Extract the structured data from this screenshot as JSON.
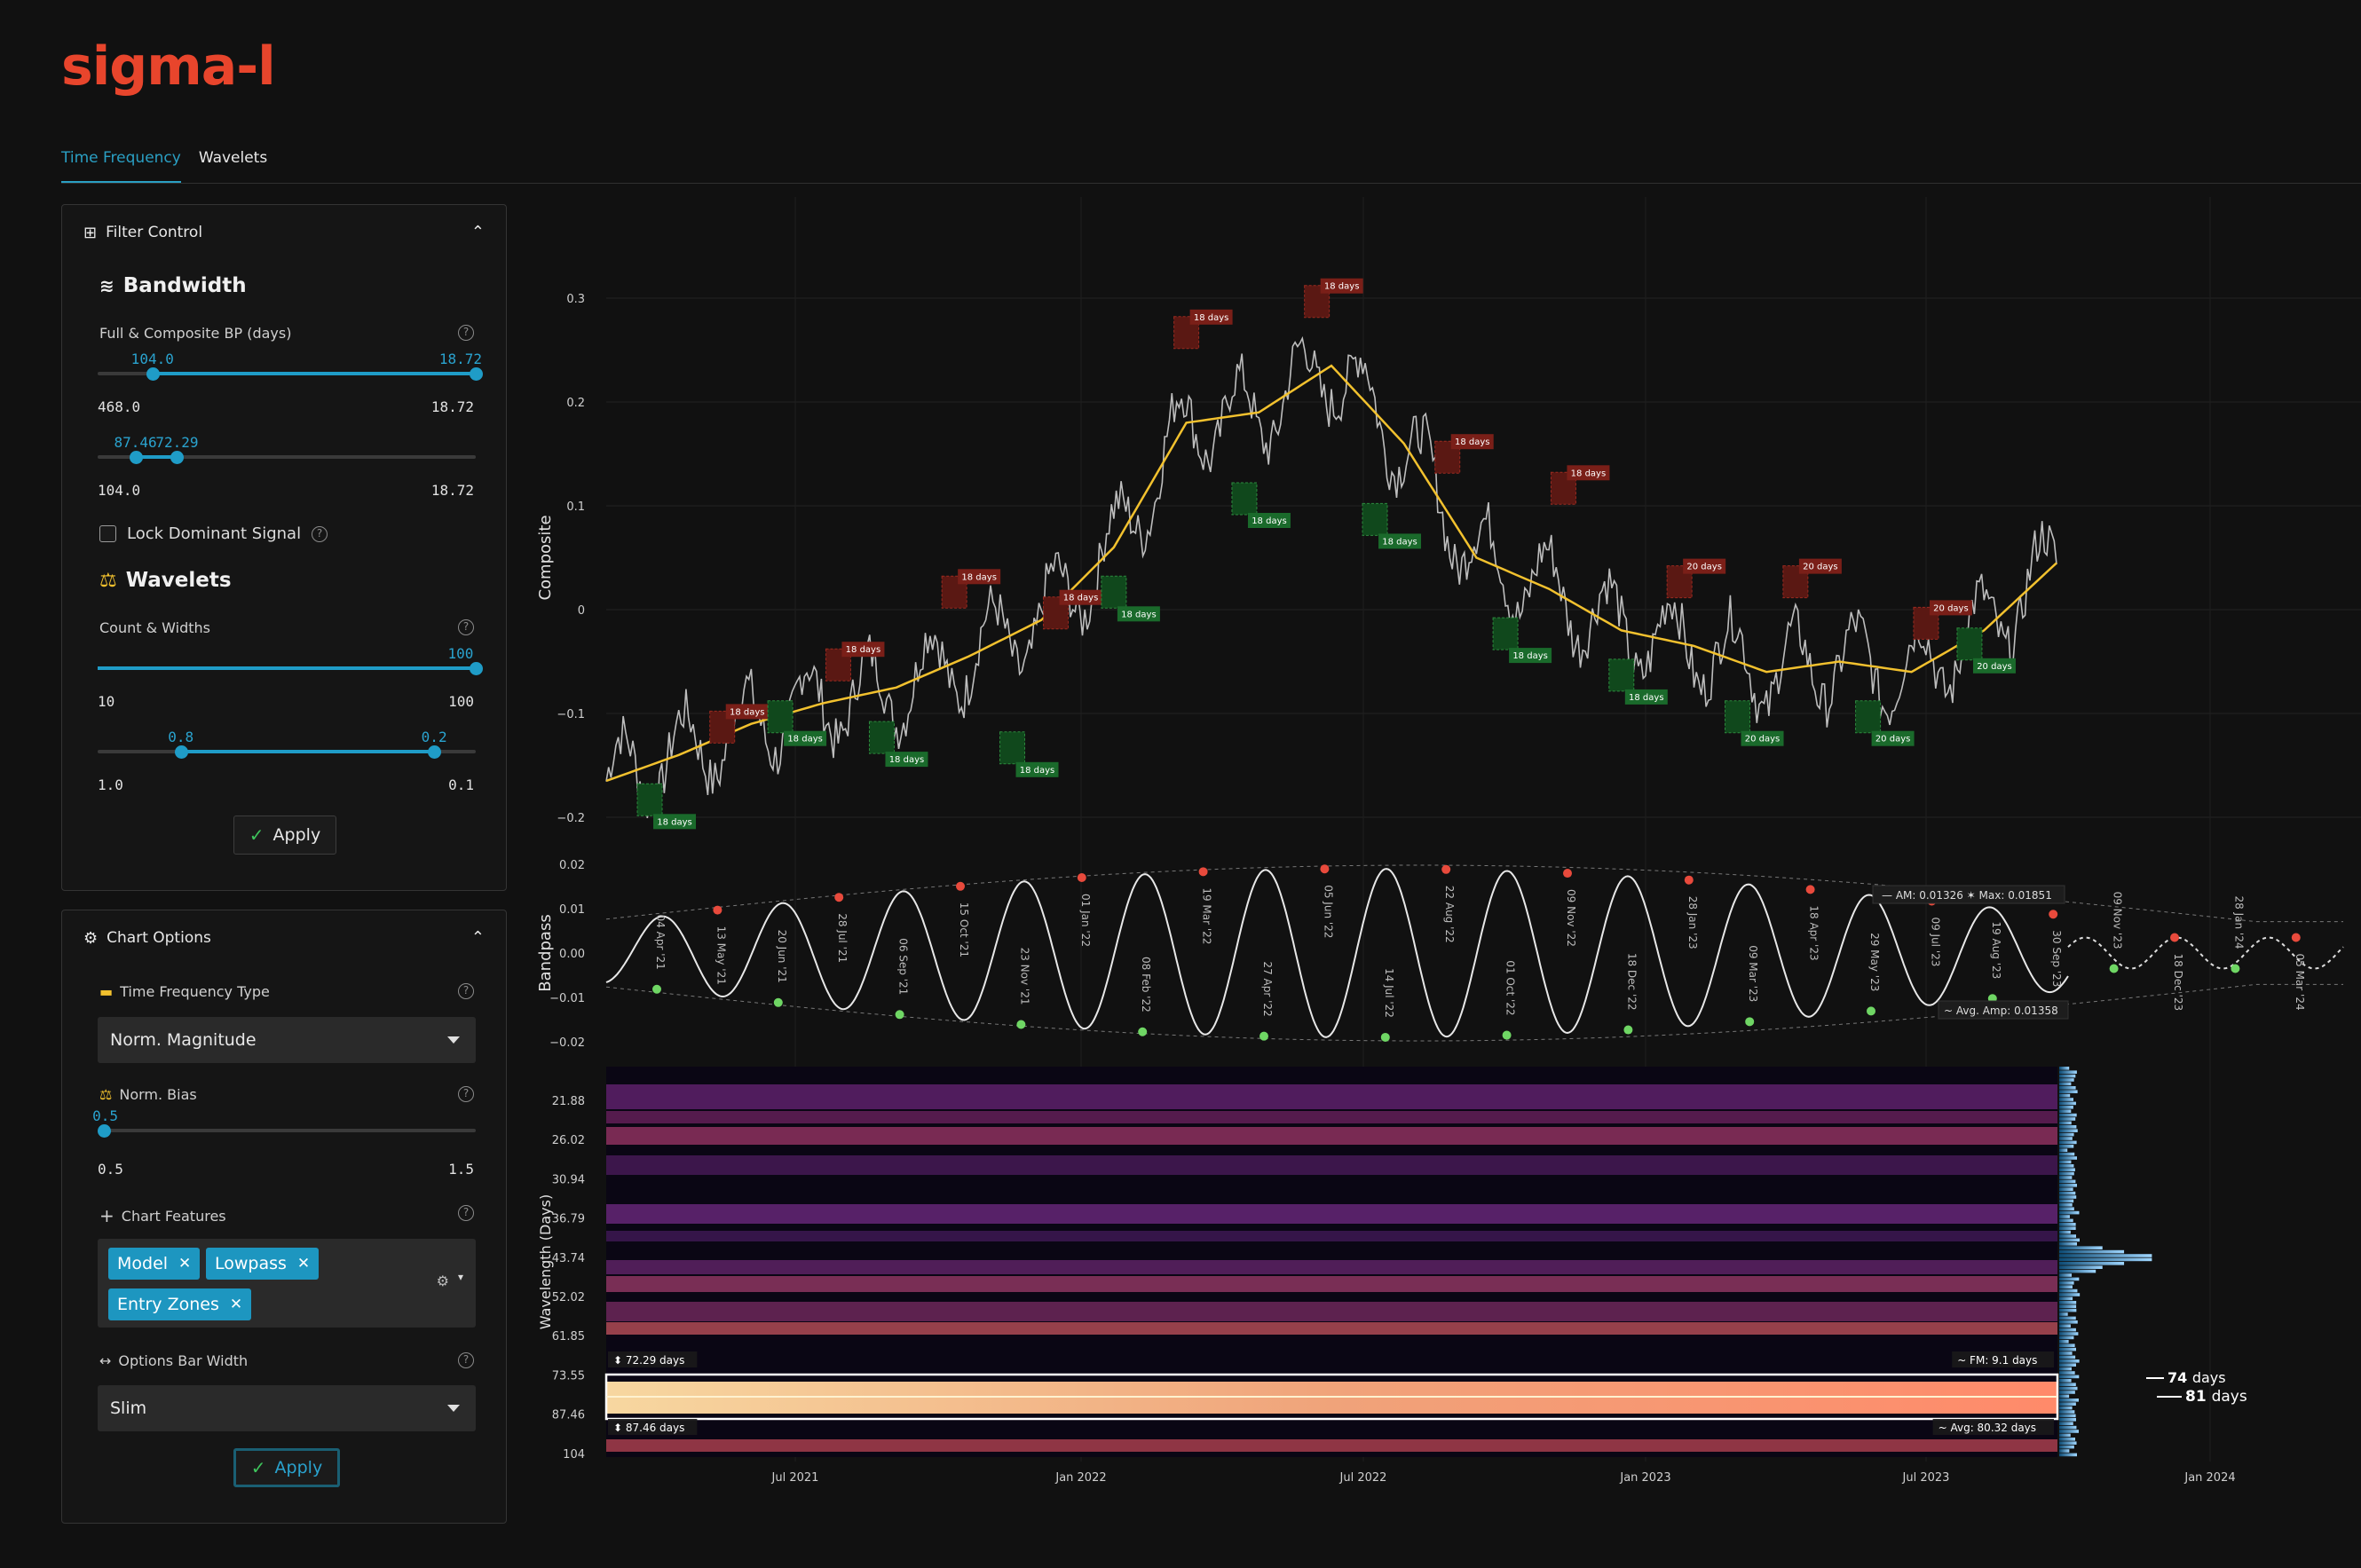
{
  "app": {
    "logo": "sigma-l"
  },
  "tabs": [
    {
      "label": "Time Frequency",
      "active": true
    },
    {
      "label": "Wavelets",
      "active": false
    }
  ],
  "filter_control": {
    "title": "Filter Control",
    "bandwidth": {
      "title": "Bandwidth",
      "full_composite_label": "Full & Composite BP (days)",
      "slider1": {
        "low": "104.0",
        "high": "18.72",
        "min": "468.0",
        "max": "18.72",
        "low_frac": 0.145,
        "high_frac": 1.0
      },
      "slider2": {
        "low": "87.46",
        "high": "72.29",
        "min": "104.0",
        "max": "18.72",
        "low_frac": 0.1,
        "high_frac": 0.21
      }
    },
    "lock_dominant_label": "Lock Dominant Signal",
    "wavelets": {
      "title": "Wavelets",
      "count_widths_label": "Count & Widths",
      "slider1": {
        "value": "100",
        "min": "10",
        "max": "100",
        "frac": 1.0
      },
      "slider2": {
        "low": "0.8",
        "high": "0.2",
        "min": "1.0",
        "max": "0.1",
        "low_frac": 0.22,
        "high_frac": 0.89
      }
    },
    "apply_label": "Apply"
  },
  "chart_options": {
    "title": "Chart Options",
    "tf_type_label": "Time Frequency Type",
    "tf_type_value": "Norm. Magnitude",
    "norm_bias_label": "Norm. Bias",
    "norm_bias": {
      "value": "0.5",
      "min": "0.5",
      "max": "1.5",
      "frac": 0.0
    },
    "chart_features_label": "Chart Features",
    "chart_features": [
      "Model",
      "Lowpass",
      "Entry Zones"
    ],
    "options_bar_width_label": "Options Bar Width",
    "options_bar_width_value": "Slim",
    "apply_label": "Apply"
  },
  "chart_data": [
    {
      "type": "line",
      "ylabel": "Composite",
      "yticks": [
        "0.3",
        "0.2",
        "0.1",
        "0",
        "−0.1",
        "−0.2"
      ],
      "ylim": [
        -0.2,
        0.3
      ],
      "entry_zone_label_red": "18 days",
      "entry_zone_label_green": "18 days",
      "entry_zone_label_red_20": "20 days",
      "entry_zone_label_green_20": "20 days",
      "lowpass": [
        [
          0,
          -0.165
        ],
        [
          0.05,
          -0.14
        ],
        [
          0.1,
          -0.11
        ],
        [
          0.15,
          -0.09
        ],
        [
          0.2,
          -0.075
        ],
        [
          0.25,
          -0.045
        ],
        [
          0.3,
          -0.01
        ],
        [
          0.35,
          0.06
        ],
        [
          0.4,
          0.18
        ],
        [
          0.45,
          0.19
        ],
        [
          0.5,
          0.235
        ],
        [
          0.55,
          0.16
        ],
        [
          0.6,
          0.05
        ],
        [
          0.65,
          0.02
        ],
        [
          0.7,
          -0.02
        ],
        [
          0.75,
          -0.035
        ],
        [
          0.8,
          -0.06
        ],
        [
          0.85,
          -0.05
        ],
        [
          0.9,
          -0.06
        ],
        [
          0.95,
          -0.02
        ],
        [
          1.0,
          0.045
        ]
      ]
    },
    {
      "type": "line",
      "ylabel": "Bandpass",
      "yticks": [
        "0.02",
        "0.01",
        "0.00",
        "−0.01",
        "−0.02"
      ],
      "ylim": [
        -0.02,
        0.02
      ],
      "am_label": "AM: 0.01326",
      "max_label": "Max: 0.01851",
      "avg_amp_label": "Avg. Amp: 0.01358",
      "date_labels": [
        "04 Apr '21",
        "13 May '21",
        "20 Jun '21",
        "28 Jul '21",
        "06 Sep '21",
        "15 Oct '21",
        "23 Nov '21",
        "01 Jan '22",
        "08 Feb '22",
        "19 Mar '22",
        "27 Apr '22",
        "05 Jun '22",
        "14 Jul '22",
        "22 Aug '22",
        "01 Oct '22",
        "09 Nov '22",
        "18 Dec '22",
        "28 Jan '23",
        "09 Mar '23",
        "18 Apr '23",
        "29 May '23",
        "09 Jul '23",
        "19 Aug '23",
        "30 Sep '23",
        "09 Nov '23",
        "18 Dec '23",
        "28 Jan '24",
        "05 Mar '24"
      ]
    },
    {
      "type": "heatmap",
      "ylabel": "Wavelength (Days)",
      "yticks": [
        "21.88",
        "26.02",
        "30.94",
        "36.79",
        "43.74",
        "52.02",
        "61.85",
        "73.55",
        "87.46",
        "104"
      ],
      "xticks": [
        "Jul 2021",
        "Jan 2022",
        "Jul 2022",
        "Jan 2023",
        "Jul 2023",
        "Jan 2024"
      ],
      "band_top_label": "72.29 days",
      "band_bottom_label": "87.46 days",
      "fm_label": "FM: 9.1 days",
      "avg_label": "Avg: 80.32 days",
      "peak1_label_num": "74",
      "peak1_label_unit": "days",
      "peak2_label_num": "81",
      "peak2_label_unit": "days"
    }
  ],
  "colors": {
    "accent": "#1f9cc7",
    "logo": "#e8452c",
    "lowpass": "#f2c12e",
    "red_zone": "#6e1a14",
    "green_zone": "#145a22"
  }
}
